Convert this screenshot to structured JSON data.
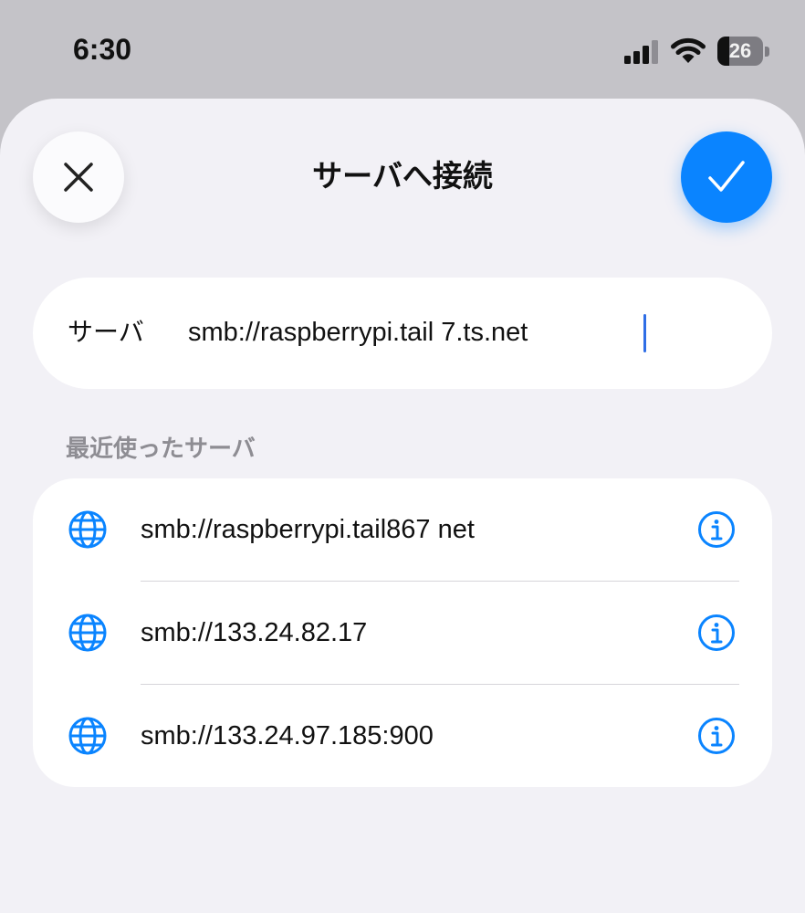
{
  "status_bar": {
    "time": "6:30",
    "battery_level": "26",
    "battery_fraction": 0.26
  },
  "header": {
    "title": "サーバへ接続",
    "close_icon": "close-icon",
    "confirm_icon": "checkmark-icon",
    "accent_color": "#0a84ff"
  },
  "server_field": {
    "label": "サーバ",
    "value": "smb://raspberrypi.tail        7.ts.net"
  },
  "recent": {
    "header": "最近使ったサーバ",
    "items": [
      {
        "address": "smb://raspberrypi.tail867          net",
        "icon": "globe-icon",
        "info_icon": "info-icon"
      },
      {
        "address": "smb://133.24.82.17",
        "icon": "globe-icon",
        "info_icon": "info-icon"
      },
      {
        "address": "smb://133.24.97.185:900",
        "icon": "globe-icon",
        "info_icon": "info-icon"
      }
    ]
  }
}
